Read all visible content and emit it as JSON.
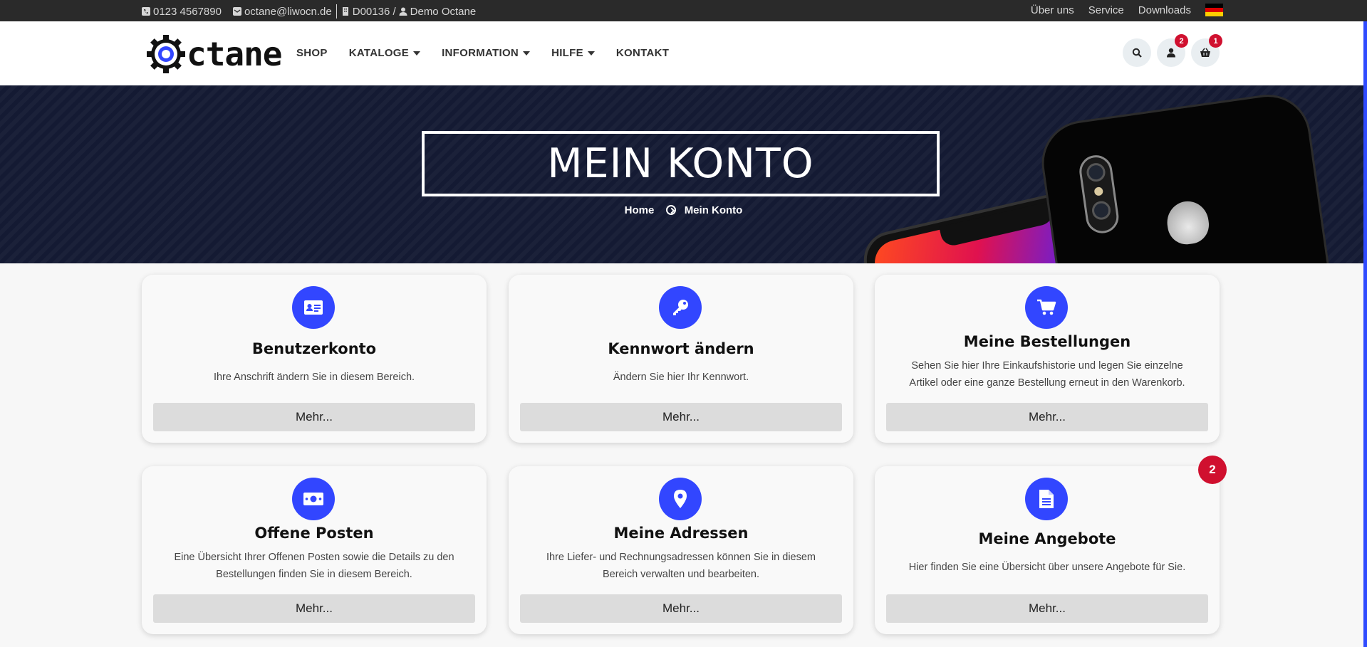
{
  "topbar": {
    "phone": "0123 4567890",
    "email": "octane@liwocn.de",
    "customer": "D00136 /",
    "user": "Demo Octane",
    "links": [
      "Über uns",
      "Service",
      "Downloads"
    ],
    "language_icon": "flag-de-icon"
  },
  "header": {
    "logo_text": "ctane",
    "nav": [
      "SHOP",
      "KATALOGE",
      "INFORMATION",
      "HILFE",
      "KONTAKT"
    ],
    "user_badge": "2",
    "cart_badge": "1"
  },
  "hero": {
    "title": "MEIN KONTO",
    "breadcrumb_home": "Home",
    "breadcrumb_current": "Mein Konto"
  },
  "cards": [
    {
      "icon": "id-card-icon",
      "title": "Benutzerkonto",
      "desc": "Ihre Anschrift ändern Sie in diesem Bereich.",
      "button": "Mehr..."
    },
    {
      "icon": "key-icon",
      "title": "Kennwort ändern",
      "desc": "Ändern Sie hier Ihr Kennwort.",
      "button": "Mehr..."
    },
    {
      "icon": "cart-icon",
      "title": "Meine Bestellungen",
      "desc": "Sehen Sie hier Ihre Einkaufshistorie und legen Sie einzelne Artikel oder eine ganze Bestellung erneut in den Warenkorb.",
      "button": "Mehr..."
    },
    {
      "icon": "money-icon",
      "title": "Offene Posten",
      "desc": "Eine Übersicht Ihrer Offenen Posten sowie die Details zu den Bestellungen finden Sie in diesem Bereich.",
      "button": "Mehr..."
    },
    {
      "icon": "map-marker-icon",
      "title": "Meine Adressen",
      "desc": "Ihre Liefer- und Rechnungsadressen können Sie in diesem Bereich verwalten und bearbeiten.",
      "button": "Mehr..."
    },
    {
      "icon": "document-icon",
      "title": "Meine Angebote",
      "desc": "Hier finden Sie eine Übersicht über unsere Angebote für Sie.",
      "button": "Mehr..."
    }
  ],
  "angebote_badge": "2",
  "colors": {
    "accent": "#3246ff",
    "badge": "#d0102f",
    "topbar": "#2a2a2a",
    "hero": "#141a33"
  }
}
